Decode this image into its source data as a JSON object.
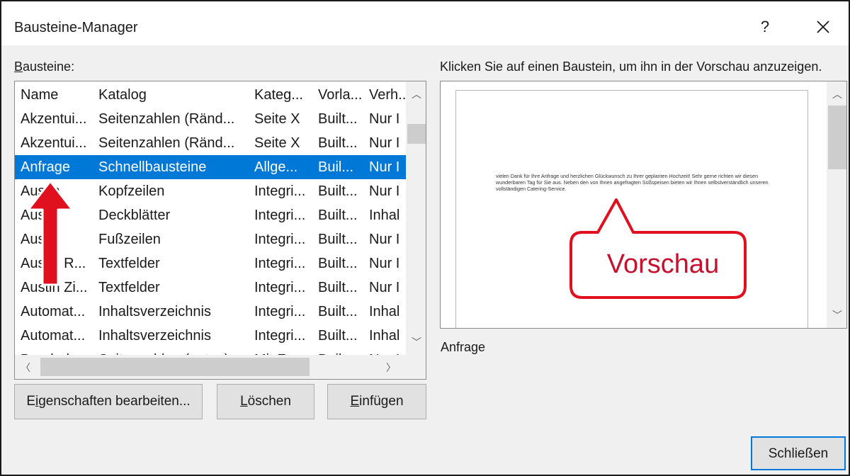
{
  "dialog": {
    "title": "Bausteine-Manager",
    "help_label": "?",
    "close_icon": "close-icon"
  },
  "list": {
    "label_accel": "B",
    "label_rest": "austeine:",
    "columns": [
      "Name",
      "Katalog",
      "Kateg...",
      "Vorla...",
      "Verh..."
    ],
    "rows": [
      [
        "Akzentui...",
        "Seitenzahlen (Ränd...",
        "Seite X",
        "Built...",
        "Nur I"
      ],
      [
        "Akzentui...",
        "Seitenzahlen (Ränd...",
        "Seite X",
        "Built...",
        "Nur I"
      ],
      [
        "Anfrage",
        "Schnellbausteine",
        "Allge...",
        "Buil...",
        "Nur I"
      ],
      [
        "Austin",
        "Kopfzeilen",
        "Integri...",
        "Built...",
        "Nur I"
      ],
      [
        "Austin",
        "Deckblätter",
        "Integri...",
        "Built...",
        "Inhal"
      ],
      [
        "Austin",
        "Fußzeilen",
        "Integri...",
        "Built...",
        "Nur I"
      ],
      [
        "Austin R...",
        "Textfelder",
        "Integri...",
        "Built...",
        "Nur I"
      ],
      [
        "Austin Zi...",
        "Textfelder",
        "Integri...",
        "Built...",
        "Nur I"
      ],
      [
        "Automat...",
        "Inhaltsverzeichnis",
        "Integri...",
        "Built...",
        "Inhal"
      ],
      [
        "Automat...",
        "Inhaltsverzeichnis",
        "Integri...",
        "Built...",
        "Inhal"
      ],
      [
        "Banded",
        "Seitenzahlen (unten)",
        "Mit F...",
        "Built...",
        "Nur I"
      ]
    ],
    "selected_index": 2
  },
  "buttons": {
    "edit_accel": "i",
    "edit_before": "E",
    "edit_after": "genschaften bearbeiten...",
    "delete_accel": "L",
    "delete_rest": "öschen",
    "insert_accel": "E",
    "insert_rest": "infügen",
    "close_label": "Schließen"
  },
  "preview": {
    "hint": "Klicken Sie auf einen Baustein, um ihn in der Vorschau anzuzeigen.",
    "text": "vielen Dank für Ihre Anfrage und herzlichen Glückwunsch zu Ihrer geplanten Hochzeit! Sehr gerne richten wir diesen wunderbaren Tag für Sie aus. Neben den von Ihnen angefragten Süßspeisen bieten wir Ihnen selbstverständlich unseren vollständigen Catering-Service.",
    "name": "Anfrage"
  },
  "annotations": {
    "callout_text": "Vorschau",
    "accent_color": "#e0101e"
  }
}
